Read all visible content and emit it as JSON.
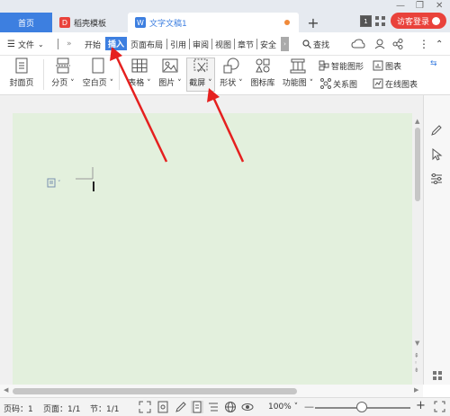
{
  "tabs": {
    "home": "首页",
    "templates": "稻壳模板",
    "document": "文字文稿1",
    "login": "访客登录"
  },
  "menu": {
    "file": "文件",
    "items": [
      "开始",
      "插入",
      "页面布局",
      "引用",
      "审阅",
      "视图",
      "章节",
      "安全"
    ],
    "search": "查找"
  },
  "ribbon": {
    "cover": "封面页",
    "page_break": "分页",
    "blank_page": "空白页",
    "table": "表格",
    "picture": "图片",
    "screenshot": "截屏",
    "shape": "形状",
    "icon_lib": "图标库",
    "function_chart": "功能图",
    "smart_art": "智能图形",
    "chart": "图表",
    "relation": "关系图",
    "online_chart": "在线图表"
  },
  "status": {
    "page_num": "页码：1",
    "pages": "页面：1/1",
    "section": "节：1/1",
    "zoom": "100%"
  },
  "colors": {
    "accent": "#3d7fe0",
    "login": "#e9423b",
    "page_bg": "#e3f0dd",
    "arrow": "#e5201f"
  }
}
